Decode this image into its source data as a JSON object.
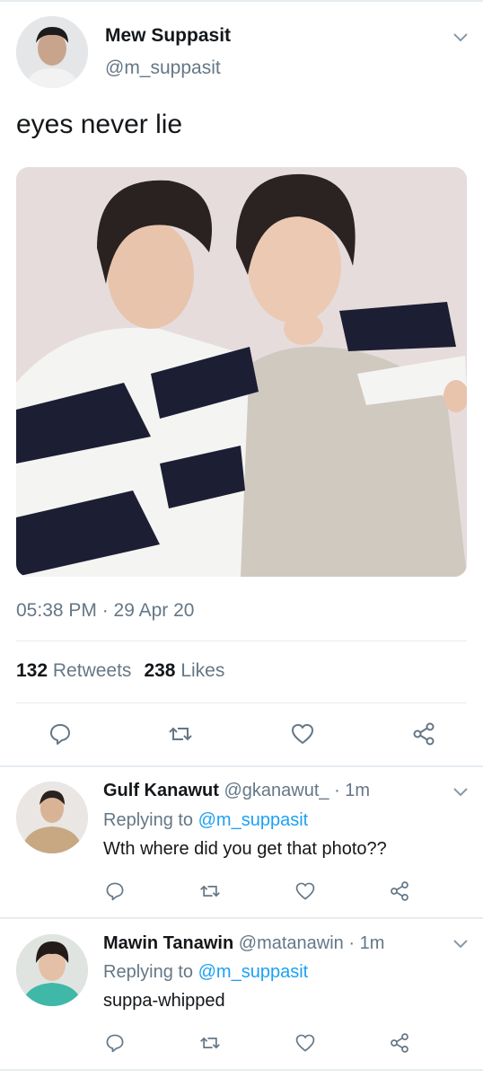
{
  "tweet": {
    "author_name": "Mew Suppasit",
    "author_handle": "@m_suppasit",
    "text": "eyes never lie",
    "timestamp": "05:38 PM · 29 Apr 20",
    "retweets_count": "132",
    "retweets_label": "Retweets",
    "likes_count": "238",
    "likes_label": "Likes",
    "photo_icon": "photo-image",
    "actions": [
      "reply-icon",
      "retweet-icon",
      "like-icon",
      "share-icon"
    ]
  },
  "replies": [
    {
      "name": "Gulf Kanawut",
      "handle": "@gkanawut_",
      "time": "· 1m",
      "replying_prefix": "Replying to",
      "replying_to": "@m_suppasit",
      "text": "Wth where did you get that photo??"
    },
    {
      "name": "Mawin Tanawin",
      "handle": "@matanawin",
      "time": "· 1m",
      "replying_prefix": "Replying to",
      "replying_to": "@m_suppasit",
      "text": "suppa-whipped"
    }
  ],
  "colors": {
    "text": "#14171a",
    "secondary": "#657786",
    "link": "#1da1f2",
    "divider": "#e6ecf0"
  }
}
